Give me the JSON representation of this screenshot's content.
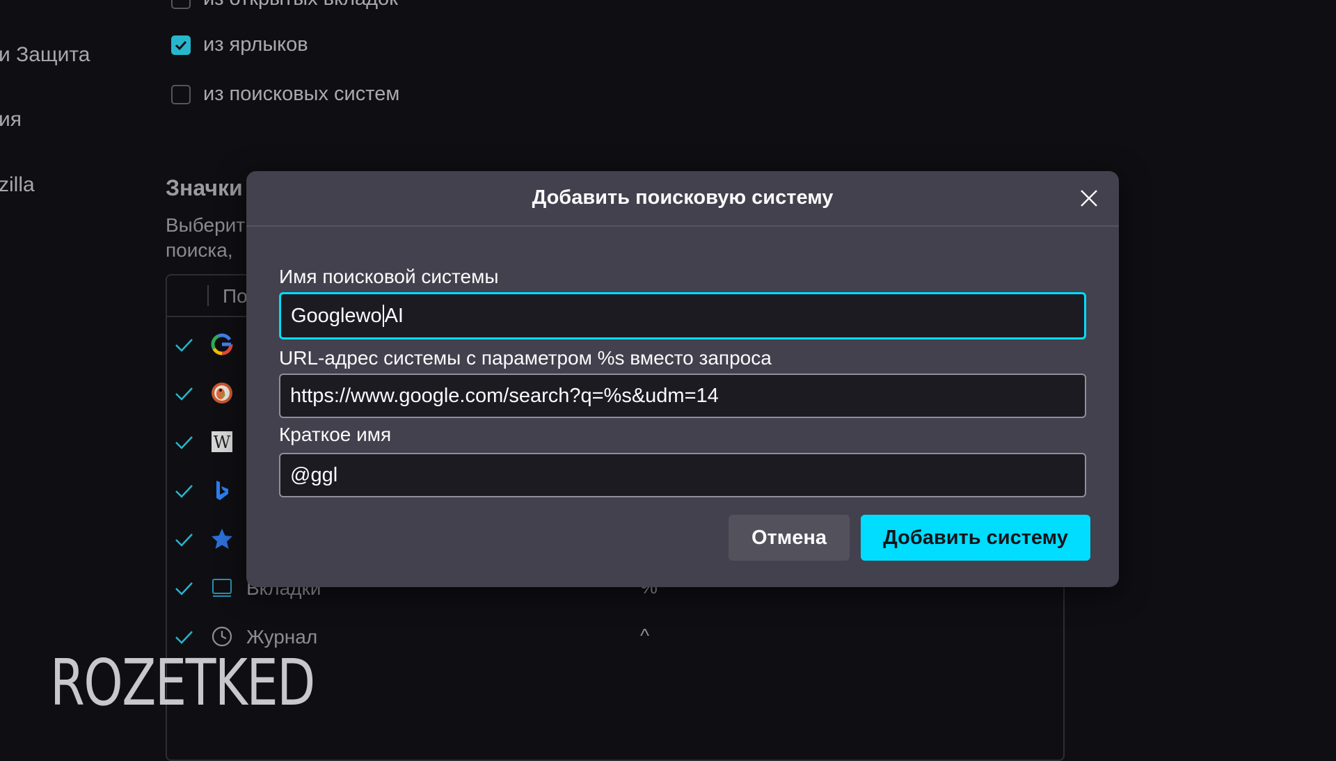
{
  "background": {
    "nav": [
      "и Защита",
      "ия",
      "zilla"
    ],
    "checkbox_partial": "из открытых вкладок",
    "checkboxes": [
      {
        "label": "из ярлыков",
        "checked": true
      },
      {
        "label": "из поисковых систем",
        "checked": false
      }
    ],
    "section_title": "Значки",
    "section_desc_line1": "Выберит",
    "section_desc_line2": "поиска,",
    "table_header": "По",
    "rows": [
      {
        "icon": "google-icon",
        "name": "",
        "keyword": ""
      },
      {
        "icon": "duckduckgo-icon",
        "name": "",
        "keyword": ""
      },
      {
        "icon": "wikipedia-icon",
        "name": "",
        "keyword": ""
      },
      {
        "icon": "bing-icon",
        "name": "",
        "keyword": ""
      },
      {
        "icon": "bookmarks-star-icon",
        "name": "",
        "keyword": ""
      },
      {
        "icon": "tabs-icon",
        "name": "Вкладки",
        "keyword": "%"
      },
      {
        "icon": "history-clock-icon",
        "name": "Журнал",
        "keyword": "^"
      }
    ],
    "watermark": "ROZETKED"
  },
  "dialog": {
    "title": "Добавить поисковую систему",
    "name_label": "Имя поисковой системы",
    "name_value_before_caret": "Googlewo",
    "name_value_after_caret": "AI",
    "url_label": "URL-адрес системы с параметром %s вместо запроса",
    "url_value": "https://www.google.com/search?q=%s&udm=14",
    "alias_label": "Краткое имя",
    "alias_value": "@ggl",
    "cancel_label": "Отмена",
    "add_label": "Добавить систему"
  },
  "colors": {
    "accent": "#00ddff",
    "dialog_bg": "#42414d",
    "page_bg": "#0f0f13",
    "check": "#27b7cc"
  }
}
